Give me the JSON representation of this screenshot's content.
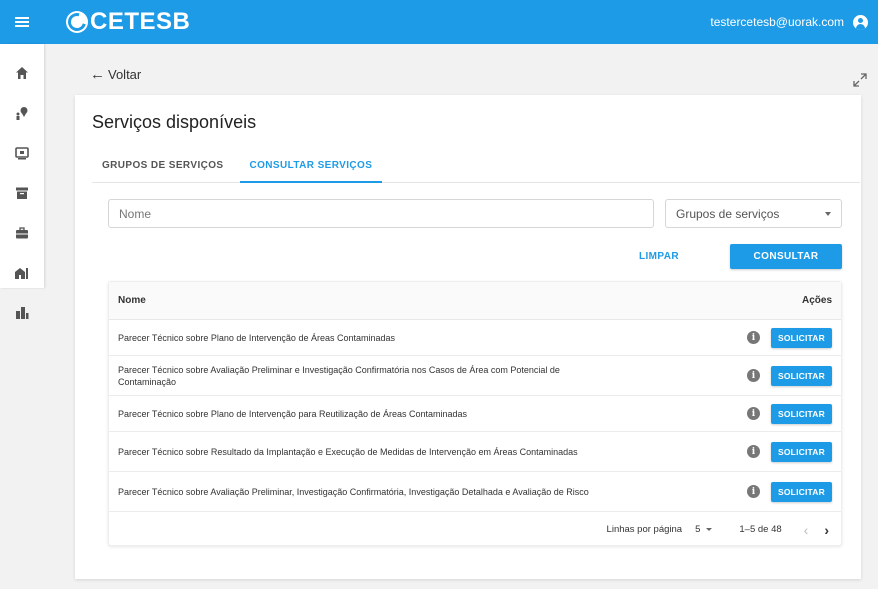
{
  "header": {
    "brand": "CETESB",
    "user_email": "testercetesb@uorak.com"
  },
  "sidebar": {
    "items": [
      {
        "icon": "home-icon"
      },
      {
        "icon": "location-person-icon"
      },
      {
        "icon": "monitor-icon"
      },
      {
        "icon": "archive-icon"
      },
      {
        "icon": "briefcase-icon"
      },
      {
        "icon": "house-key-icon"
      },
      {
        "icon": "buildings-icon"
      }
    ]
  },
  "nav": {
    "back_label": "Voltar"
  },
  "main": {
    "title": "Serviços disponíveis",
    "tabs": [
      {
        "label": "GRUPOS DE SERVIÇOS",
        "active": false
      },
      {
        "label": "CONSULTAR SERVIÇOS",
        "active": true
      }
    ],
    "name_placeholder": "Nome",
    "group_select_placeholder": "Grupos de serviços",
    "clear_label": "LIMPAR",
    "consult_label": "CONSULTAR"
  },
  "table": {
    "col_name": "Nome",
    "col_actions": "Ações",
    "request_label": "SOLICITAR",
    "info_glyph": "i",
    "rows": [
      "Parecer Técnico sobre Plano de Intervenção de Áreas Contaminadas",
      "Parecer Técnico sobre Avaliação Preliminar e Investigação Confirmatória nos Casos de Área com Potencial de Contaminação",
      "Parecer Técnico sobre Plano de Intervenção para Reutilização de Áreas Contaminadas",
      "Parecer Técnico sobre Resultado da Implantação e Execução de Medidas de Intervenção em Áreas Contaminadas",
      "Parecer Técnico sobre Avaliação Preliminar, Investigação Confirmatória, Investigação Detalhada e Avaliação de Risco"
    ]
  },
  "pagination": {
    "rows_per_page_label": "Linhas por página",
    "rows_per_page_value": "5",
    "range": "1–5 de 48"
  },
  "colors": {
    "primary": "#1e9be6"
  }
}
